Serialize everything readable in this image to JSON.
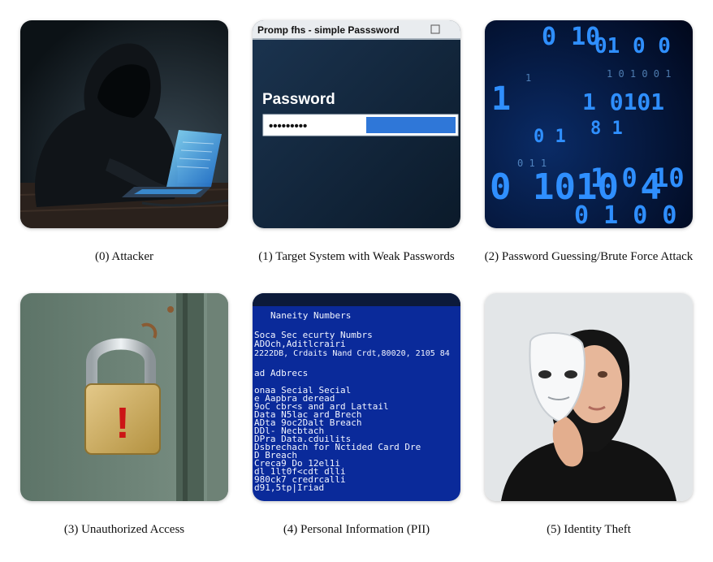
{
  "panels": [
    {
      "caption": "(0) Attacker",
      "icon": "hooded-hacker-laptop-icon"
    },
    {
      "caption": "(1) Target System with Weak Passwords",
      "icon": "password-prompt-icon",
      "window_title": "Promp fhs - simple Passsword",
      "heading": "Password",
      "masked": "•••••••••"
    },
    {
      "caption": "(2) Password Guessing/Brute Force Attack",
      "icon": "binary-code-icon",
      "digits": [
        "0 10",
        "01 0 0",
        "1",
        "1 0101",
        "0 1",
        "8 1",
        "0 1010 4",
        "1 0 10 0 0",
        "0 1 0 0"
      ]
    },
    {
      "caption": "(3) Unauthorized Access",
      "icon": "broken-padlock-icon",
      "mark": "!"
    },
    {
      "caption": "(4) Personal Information (PII)",
      "icon": "pii-terminal-icon",
      "lines": [
        "Naneity Numbers",
        "Soca Sec ecurty Numbrs",
        "ADOch,Aditlcrairi",
        "2222DB, Crdaits Nand Crdt,80020, 2105 84",
        "ad Adbrecs",
        "onaa Secial Secial",
        "e Aapbra deread",
        "9oC cbr<s and ard Lattail",
        "Data N5lac ard Brech",
        "ADta 9oc2Dalt Breach",
        "DDl- Necbtach",
        "DPra Data.cduilits",
        "Dsbrechach for Nctided Card Dre",
        "D Breach",
        "Creca9 Do 12el1i",
        "dl 1lt0f<cdt dlli",
        "980ck7 credrcalli",
        "d91,5tp|Iriad"
      ]
    },
    {
      "caption": "(5) Identity Theft",
      "icon": "mask-face-icon"
    }
  ]
}
